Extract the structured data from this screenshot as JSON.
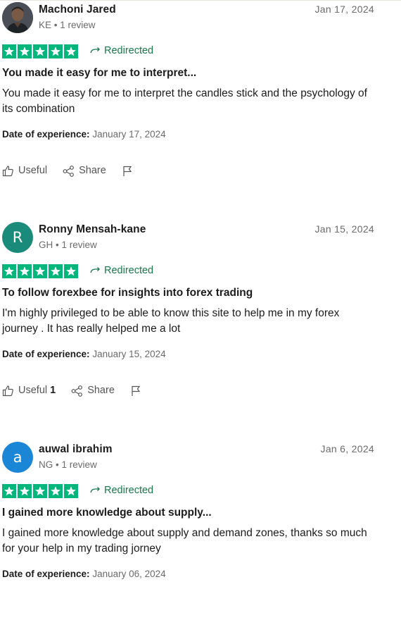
{
  "colors": {
    "star_green": "#00b67a",
    "link_green": "#16784a",
    "avatar_teal": "#1a8a7a",
    "avatar_blue": "#1b85d6"
  },
  "reviews": [
    {
      "avatar_type": "photo",
      "name": "Machoni Jared",
      "country": "KE",
      "review_count": "1 review",
      "date": "Jan 17, 2024",
      "rating": 5,
      "redirected": "Redirected",
      "title": "You made it easy for me to interpret...",
      "body": "You made it easy for me to interpret the candles stick and the psychology of its combination",
      "experience_label": "Date of experience:",
      "experience_date": "January 17, 2024",
      "useful_label": "Useful",
      "useful_count": "",
      "share_label": "Share"
    },
    {
      "avatar_type": "initial",
      "avatar_initial": "R",
      "name": "Ronny Mensah-kane",
      "country": "GH",
      "review_count": "1 review",
      "date": "Jan 15, 2024",
      "rating": 5,
      "redirected": "Redirected",
      "title": "To follow forexbee for insights into forex trading",
      "body": "I'm highly privileged to be able to know this site to help me in my forex journey . It has really helped me a lot",
      "experience_label": "Date of experience:",
      "experience_date": "January 15, 2024",
      "useful_label": "Useful",
      "useful_count": "1",
      "share_label": "Share"
    },
    {
      "avatar_type": "initial",
      "avatar_initial": "a",
      "name": "auwal ibrahim",
      "country": "NG",
      "review_count": "1 review",
      "date": "Jan 6, 2024",
      "rating": 5,
      "redirected": "Redirected",
      "title": "I gained more knowledge about supply...",
      "body": "I gained more knowledge about supply and demand zones, thanks so much for your help in my trading jorney",
      "experience_label": "Date of experience:",
      "experience_date": "January 06, 2024",
      "useful_label": "Useful",
      "useful_count": "",
      "share_label": "Share"
    }
  ]
}
